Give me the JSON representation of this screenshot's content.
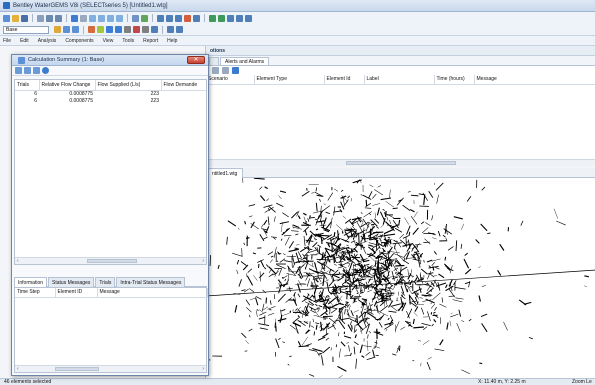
{
  "window": {
    "title": "Bentley WaterGEMS V8i (SELECTseries 5) [Untitled1.wtg]"
  },
  "toolbar": {
    "scenario_combo": "Base"
  },
  "menu": {
    "items": [
      "File",
      "Edit",
      "Analysis",
      "Components",
      "View",
      "Tools",
      "Report",
      "Help"
    ]
  },
  "results_panel": {
    "title": "otions",
    "tabs": [
      "",
      "Alerts and Alarms"
    ],
    "columns": [
      "Scenario",
      "Element Type",
      "Element Id",
      "Label",
      "Time (hours)",
      "Message"
    ]
  },
  "drawing": {
    "tab": "ntitled1.wtg"
  },
  "status": {
    "left": "46 elements selected",
    "coords": "X: 11.40 m, Y: 2.25 m",
    "zoom": "Zoom Le"
  },
  "dialog": {
    "title": "Calculation Summary (1: Base)",
    "close_glyph": "✕",
    "columns": [
      "Trials",
      "Relative Flow Change",
      "Flow Supplied (L/s)",
      "Flow Demande"
    ],
    "rows": [
      {
        "trials": "6",
        "change": "0.0008775",
        "supplied": "223"
      },
      {
        "trials": "6",
        "change": "0.0008775",
        "supplied": "223"
      }
    ],
    "tabs": [
      "Information",
      "Status Messages",
      "Trials",
      "Intra-Trial Status Messages"
    ],
    "msg_columns": [
      "Time Step",
      "Element ID",
      "Message"
    ],
    "scroll_left": "‹",
    "scroll_right": "›"
  },
  "colors": {
    "accent": "#2a6bc4",
    "close": "#c7402f",
    "network": "#000000"
  }
}
